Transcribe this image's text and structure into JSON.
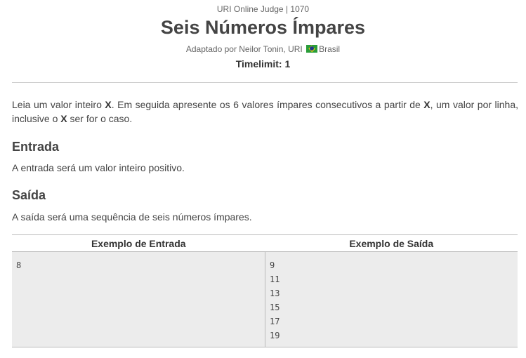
{
  "header": {
    "judge": "URI Online Judge | 1070",
    "title": "Seis Números Ímpares",
    "author_prefix": "Adaptado por Neilor Tonin, URI",
    "country": "Brasil",
    "timelimit": "Timelimit: 1"
  },
  "description": {
    "t1": "Leia um valor inteiro ",
    "x1": "X",
    "t2": ". Em seguida apresente os 6 valores ímpares consecutivos a partir de ",
    "x2": "X",
    "t3": ", um valor por linha, inclusive o ",
    "x3": "X",
    "t4": " ser for o caso."
  },
  "input_section": {
    "title": "Entrada",
    "text": "A entrada será um valor inteiro positivo."
  },
  "output_section": {
    "title": "Saída",
    "text": "A saída será uma sequência de seis números ímpares."
  },
  "examples": {
    "input_header": "Exemplo de Entrada",
    "output_header": "Exemplo de Saída",
    "input_lines": [
      "8"
    ],
    "output_lines": [
      "9",
      "11",
      "13",
      "15",
      "17",
      "19"
    ]
  },
  "colors": {
    "flag_green": "#2a9d3a",
    "flag_yellow": "#f2d600",
    "flag_blue": "#1e3a8c"
  }
}
